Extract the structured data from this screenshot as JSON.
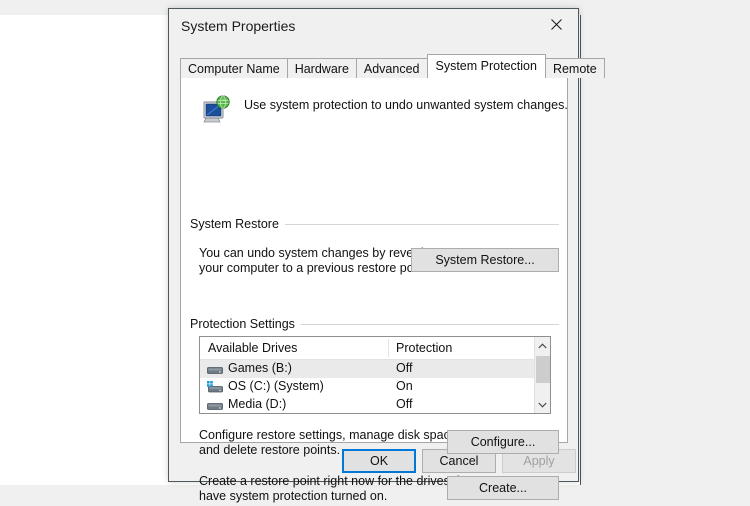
{
  "dialog": {
    "title": "System Properties",
    "close_icon": "close-icon"
  },
  "tabs": [
    {
      "label": "Computer Name",
      "active": false
    },
    {
      "label": "Hardware",
      "active": false
    },
    {
      "label": "Advanced",
      "active": false
    },
    {
      "label": "System Protection",
      "active": true
    },
    {
      "label": "Remote",
      "active": false
    }
  ],
  "header": {
    "icon": "system-protection-monitor-icon",
    "text": "Use system protection to undo unwanted system changes."
  },
  "system_restore": {
    "legend": "System Restore",
    "description_line1": "You can undo system changes by reverting",
    "description_line2": "your computer to a previous restore point.",
    "button_label": "System Restore..."
  },
  "protection_settings": {
    "legend": "Protection Settings",
    "columns": [
      "Available Drives",
      "Protection"
    ],
    "rows": [
      {
        "icon": "hard-drive-icon",
        "drive": "Games (B:)",
        "protection": "Off",
        "hovered": true
      },
      {
        "icon": "windows-system-drive-icon",
        "drive": "OS (C:) (System)",
        "protection": "On",
        "hovered": false
      },
      {
        "icon": "hard-drive-icon",
        "drive": "Media (D:)",
        "protection": "Off",
        "hovered": false
      }
    ],
    "scroll_up_icon": "chevron-up-icon",
    "scroll_down_icon": "chevron-down-icon",
    "configure_description_line1": "Configure restore settings, manage disk space,",
    "configure_description_line2": "and delete restore points.",
    "configure_button_label": "Configure...",
    "create_description_line1": "Create a restore point right now for the drives that",
    "create_description_line2": "have system protection turned on.",
    "create_button_label": "Create..."
  },
  "footer": {
    "ok_label": "OK",
    "cancel_label": "Cancel",
    "apply_label": "Apply",
    "apply_disabled": true
  },
  "colors": {
    "accent": "#0078d7",
    "dialog_bg": "#f0f0f0",
    "page_bg": "#ffffff",
    "border": "#a6a6a6",
    "button_face": "#e1e1e1",
    "disabled_text": "#a0a0a0"
  }
}
